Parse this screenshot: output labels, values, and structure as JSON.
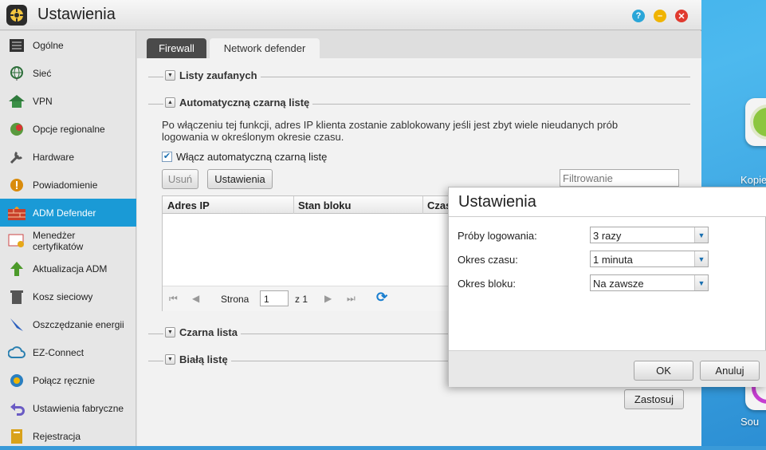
{
  "window": {
    "title": "Ustawienia"
  },
  "sidebar": {
    "items": [
      {
        "label": "Ogólne",
        "icon": "server-icon"
      },
      {
        "label": "Sieć",
        "icon": "globe-icon"
      },
      {
        "label": "VPN",
        "icon": "vpn-house-icon"
      },
      {
        "label": "Opcje regionalne",
        "icon": "region-icon"
      },
      {
        "label": "Hardware",
        "icon": "hardware-icon"
      },
      {
        "label": "Powiadomienie",
        "icon": "alert-icon"
      },
      {
        "label": "ADM Defender",
        "icon": "firewall-icon",
        "active": true
      },
      {
        "label": "Menedżer certyfikatów",
        "icon": "certificate-icon"
      },
      {
        "label": "Aktualizacja ADM",
        "icon": "update-arrow-icon"
      },
      {
        "label": "Kosz sieciowy",
        "icon": "trash-icon"
      },
      {
        "label": "Oszczędzanie energii",
        "icon": "energy-icon"
      },
      {
        "label": "EZ-Connect",
        "icon": "cloud-icon"
      },
      {
        "label": "Połącz ręcznie",
        "icon": "connect-icon"
      },
      {
        "label": "Ustawienia fabryczne",
        "icon": "reset-arrow-icon"
      },
      {
        "label": "Rejestracja",
        "icon": "register-icon"
      }
    ]
  },
  "tabs": [
    {
      "label": "Firewall"
    },
    {
      "label": "Network defender",
      "active": true
    }
  ],
  "sections": {
    "trusted": "Listy zaufanych",
    "auto_blacklist": "Automatyczną czarną listę",
    "blacklist": "Czarna lista",
    "whitelist": "Białą listę"
  },
  "auto": {
    "description": "Po włączeniu tej funkcji, adres IP klienta zostanie zablokowany jeśli jest zbyt wiele nieudanych prób logowania w określonym okresie czasu.",
    "checkbox_label": "Włącz automatyczną czarną listę",
    "checked": true,
    "remove_btn": "Usuń",
    "settings_btn": "Ustawienia",
    "filter_placeholder": "Filtrowanie",
    "columns": [
      "Adres IP",
      "Stan bloku",
      "Czas"
    ],
    "pager": {
      "page_label": "Strona",
      "page": "1",
      "of_label": "z 1"
    }
  },
  "apply_btn": "Zastosuj",
  "dialog": {
    "title": "Ustawienia",
    "fields": [
      {
        "label": "Próby logowania:",
        "value": "3 razy"
      },
      {
        "label": "Okres czasu:",
        "value": "1 minuta"
      },
      {
        "label": "Okres bloku:",
        "value": "Na zawsze"
      }
    ],
    "ok": "OK",
    "cancel": "Anuluj"
  },
  "desktop": {
    "labels": [
      "Kopie",
      "Sou"
    ]
  },
  "colors": {
    "accent": "#1a9ad6",
    "help": "#2aa6d8",
    "minimize": "#f0b400",
    "close": "#e03a2f"
  }
}
